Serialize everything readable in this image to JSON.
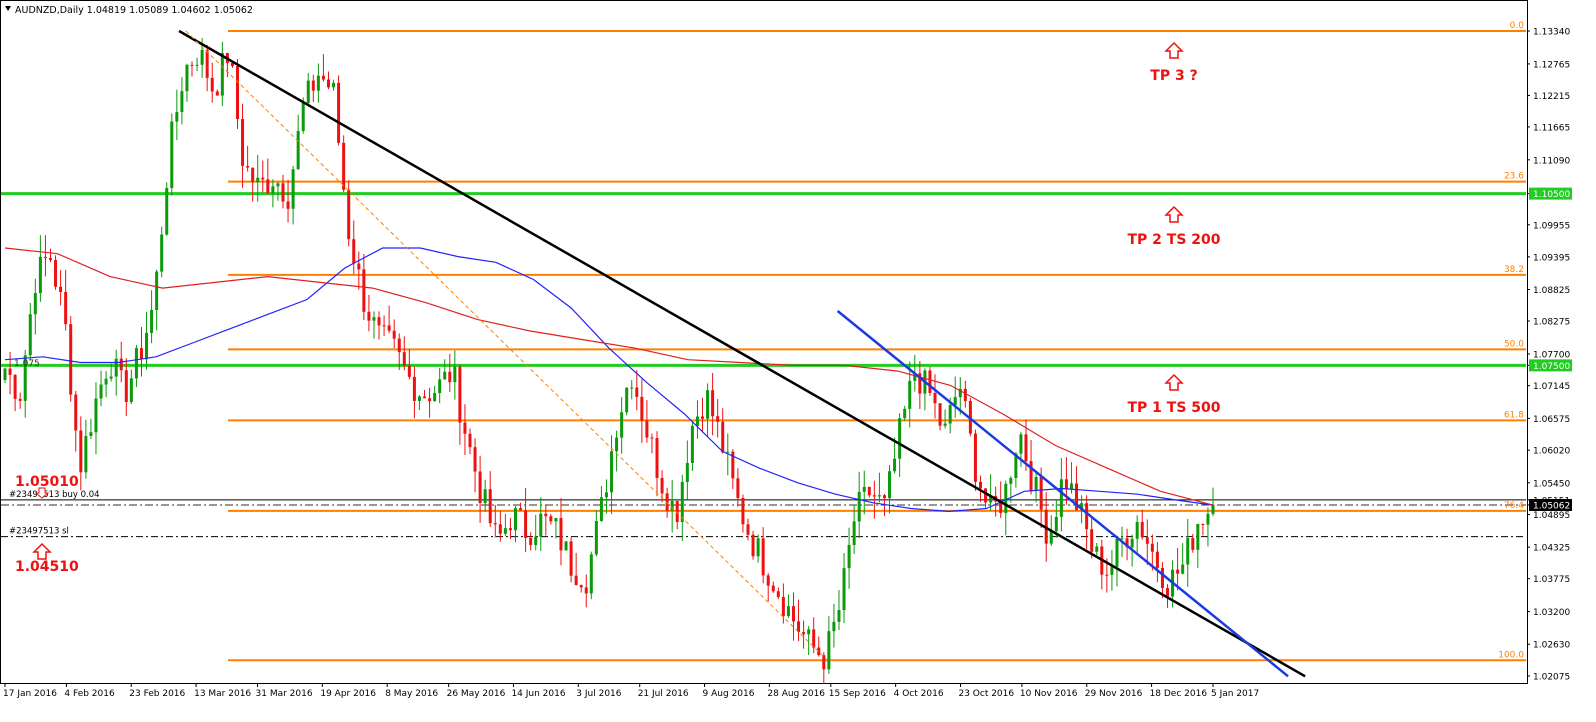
{
  "chart_data": {
    "type": "candlestick",
    "symbol_header": "AUDNZD,Daily  1.04819 1.05089 1.04602 1.05062",
    "price_axis": {
      "labels": [
        "1.13340",
        "1.12765",
        "1.12215",
        "1.11665",
        "1.11090",
        "1.10500",
        "1.09955",
        "1.09395",
        "1.08825",
        "1.08275",
        "1.07700",
        "1.07500",
        "1.07145",
        "1.06575",
        "1.06020",
        "1.05450",
        "1.05151",
        "1.05062",
        "1.04895",
        "1.04325",
        "1.03775",
        "1.03200",
        "1.02630",
        "1.02075"
      ]
    },
    "time_axis": {
      "labels": [
        "17 Jan 2016",
        "4 Feb 2016",
        "23 Feb 2016",
        "13 Mar 2016",
        "31 Mar 2016",
        "19 Apr 2016",
        "8 May 2016",
        "26 May 2016",
        "14 Jun 2016",
        "3 Jul 2016",
        "21 Jul 2016",
        "9 Aug 2016",
        "28 Aug 2016",
        "15 Sep 2016",
        "4 Oct 2016",
        "23 Oct 2016",
        "10 Nov 2016",
        "29 Nov 2016",
        "18 Dec 2016",
        "5 Jan 2017"
      ]
    },
    "price_path": [
      1.0745,
      1.07,
      1.09,
      1.0945,
      1.083,
      1.057,
      1.068,
      1.0765,
      1.07,
      1.0765,
      1.086,
      1.112,
      1.1265,
      1.13,
      1.123,
      1.13,
      1.11,
      1.106,
      1.108,
      1.105,
      1.12,
      1.126,
      1.123,
      1.099,
      1.087,
      1.08,
      1.078,
      1.073,
      1.07,
      1.071,
      1.074,
      1.062,
      1.052,
      1.044,
      1.049,
      1.046,
      1.048,
      1.046,
      1.04,
      1.038,
      1.05,
      1.065,
      1.074,
      1.064,
      1.055,
      1.049,
      1.064,
      1.07,
      1.062,
      1.052,
      1.045,
      1.04,
      1.035,
      1.03,
      1.026,
      1.024,
      1.033,
      1.049,
      1.053,
      1.05,
      1.063,
      1.074,
      1.07,
      1.063,
      1.072,
      1.058,
      1.049,
      1.052,
      1.064,
      1.054,
      1.045,
      1.056,
      1.05,
      1.042,
      1.039,
      1.045,
      1.048,
      1.042,
      1.037,
      1.04,
      1.048,
      1.0506
    ],
    "moving_averages": [
      {
        "color": "#2222ff",
        "values": [
          1.076,
          1.0765,
          1.0755,
          1.0755,
          1.0765,
          1.079,
          1.0815,
          1.084,
          1.0865,
          1.092,
          1.0955,
          1.0955,
          1.094,
          1.093,
          1.09,
          1.085,
          1.078,
          1.072,
          1.0665,
          1.06,
          1.057,
          1.0545,
          1.0525,
          1.051,
          1.05,
          1.0495,
          1.05,
          1.053,
          1.0535,
          1.053,
          1.0525,
          1.0515,
          1.0506
        ]
      },
      {
        "color": "#e02020",
        "values": [
          1.0955,
          1.0945,
          1.0905,
          1.0885,
          1.0895,
          1.0905,
          1.0895,
          1.0885,
          1.086,
          1.083,
          1.081,
          1.0795,
          1.078,
          1.076,
          1.0755,
          1.075,
          1.075,
          1.074,
          1.0715,
          1.0665,
          1.061,
          1.057,
          1.053,
          1.0506
        ]
      }
    ],
    "fibonacci": {
      "color": "#ff8000",
      "levels": [
        {
          "label": "0.0",
          "price": 1.1334
        },
        {
          "label": "23.6",
          "price": 1.1071
        },
        {
          "label": "38.2",
          "price": 1.0908
        },
        {
          "label": "50.0",
          "price": 1.0778
        },
        {
          "label": "61.8",
          "price": 1.0654
        },
        {
          "label": "76.4",
          "price": 1.0496
        },
        {
          "label": "100.0",
          "price": 1.0235
        }
      ]
    },
    "horizontal_levels": [
      {
        "price": 1.105,
        "tag": "1.10500",
        "color": "#22cc22"
      },
      {
        "price": 1.075,
        "tag": "1.07500",
        "color": "#22cc22"
      }
    ],
    "order_lines": [
      {
        "label": "#23497513 buy 0.04",
        "price": 1.05151
      },
      {
        "label": "#23497513 sl",
        "price": 1.0451
      }
    ],
    "bid_line": {
      "price": 1.05062,
      "tag": "1.05062"
    },
    "annotations": [
      {
        "text": "TP 3 ?",
        "color": "#ee1111"
      },
      {
        "text": "TP 2 TS 200",
        "color": "#ee1111"
      },
      {
        "text": "TP 1 TS 500",
        "color": "#ee1111"
      },
      {
        "text": "1.05010",
        "color": "#ee1111"
      },
      {
        "text": "1.04510",
        "color": "#ee1111"
      },
      {
        "text": "1.075",
        "color": "#333333"
      }
    ],
    "trendlines": [
      {
        "name": "black-downtrend",
        "color": "#000000",
        "from": {
          "date": "8 Mar 2016",
          "price": 1.1334
        },
        "to": {
          "date": "1 Feb 2017",
          "price": 1.0207
        }
      },
      {
        "name": "blue-downtrend",
        "color": "#1a3be0",
        "from": {
          "date": "17 Sep 2016",
          "price": 1.0845
        },
        "to": {
          "date": "27 Jan 2017",
          "price": 1.0207
        }
      },
      {
        "name": "fib-guide",
        "color": "#ff8000",
        "style": "dashed",
        "from": {
          "date": "10 Mar 2016",
          "price": 1.1334
        },
        "to": {
          "date": "14 Sep 2016",
          "price": 1.0235
        }
      }
    ],
    "colors": {
      "bull": "#0a9a0a",
      "bear": "#ee1111",
      "grid": "#000000",
      "background": "#ffffff"
    }
  }
}
